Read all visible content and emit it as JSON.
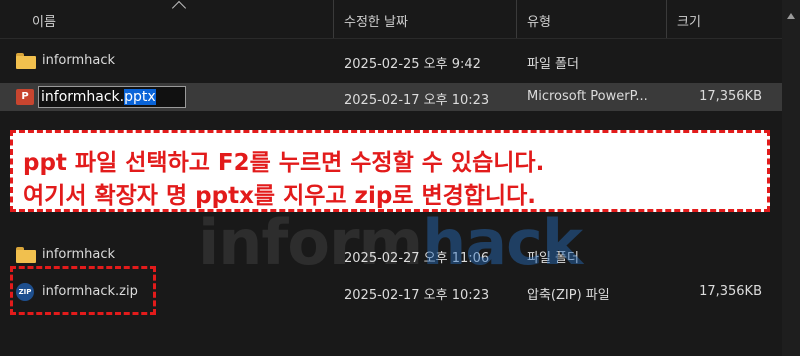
{
  "columns": {
    "name": "이름",
    "modified": "수정한 날짜",
    "type": "유형",
    "size": "크기"
  },
  "top_rows": [
    {
      "name": "informhack",
      "modified": "2025-02-25 오후 9:42",
      "type": "파일 폴더",
      "size": ""
    },
    {
      "name_base": "informhack.",
      "name_ext": "pptx",
      "modified": "2025-02-17 오후 10:23",
      "type": "Microsoft PowerP...",
      "size": "17,356KB"
    }
  ],
  "bottom_rows": [
    {
      "name": "informhack",
      "modified": "2025-02-27 오후 11:06",
      "type": "파일 폴더",
      "size": ""
    },
    {
      "name": "informhack.zip",
      "modified": "2025-02-17 오후 10:23",
      "type": "압축(ZIP) 파일",
      "size": "17,356KB"
    }
  ],
  "callout": {
    "line1": "ppt 파일 선택하고 F2를 누르면 수정할 수 있습니다.",
    "line2": "여기서 확장자 명 pptx를 지우고 zip로 변경합니다."
  },
  "watermark": {
    "part1": "inform",
    "part2": "hack"
  },
  "icons": {
    "folder": "folder-icon",
    "ppt": "powerpoint-file-icon",
    "zip": "zip-file-icon"
  },
  "colors": {
    "accent_red": "#e21b1b",
    "selection": "#0a64d8",
    "folder": "#f1c04e"
  }
}
